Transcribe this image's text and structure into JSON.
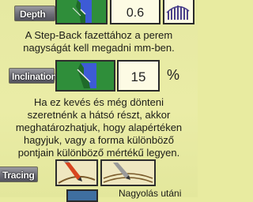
{
  "depth": {
    "label": "Depth",
    "value": "0.6",
    "icon": "depth-profile-icon",
    "chart_icon": "bar-chart-icon"
  },
  "step_back_text": "A Step-Back fazettához a perem nagyságát kell megadni mm-ben.",
  "inclination": {
    "label": "Inclination",
    "value": "15",
    "unit": "%",
    "icon": "inclination-profile-icon"
  },
  "inclination_text": "Ha ez kevés és még dönteni szeretnénk a hátsó részt, akkor meghatározhatjuk, hogy alapértéken hagyjuk, vagy a forma különböző pontjain különböző mértékű legyen.",
  "tracing": {
    "label": "Tracing",
    "option1_icon": "tracing-stylus-icon",
    "option2_icon": "tracing-stylus-alt-icon"
  },
  "bottom": {
    "partial_text": "Nagyolás utáni"
  },
  "colors": {
    "background": "#e8eba0",
    "icon_green": "#2f8e3a",
    "icon_blue": "#3d5bd6"
  }
}
